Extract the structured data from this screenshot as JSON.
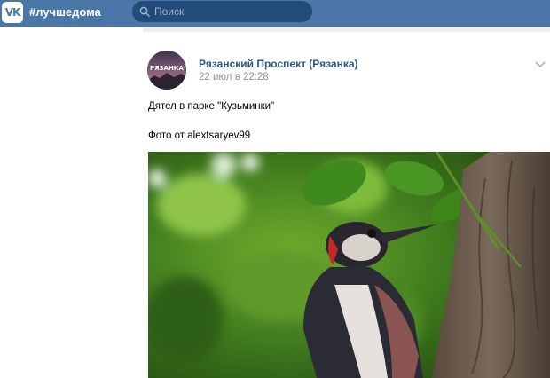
{
  "header": {
    "logo_text": "VK",
    "hashtag": "#лучшедома",
    "search_placeholder": "Поиск"
  },
  "post": {
    "avatar_text": "РЯЗАНКА",
    "author": "Рязанский Проспект (Рязанка)",
    "date": "22 июл в 22:28",
    "text_line1": "Дятел в парке \"Кузьминки\"",
    "text_line2": "Фото от alextsaryev99"
  },
  "colors": {
    "topbar": "#4a76a8",
    "link": "#2a5885",
    "muted": "#939393"
  }
}
